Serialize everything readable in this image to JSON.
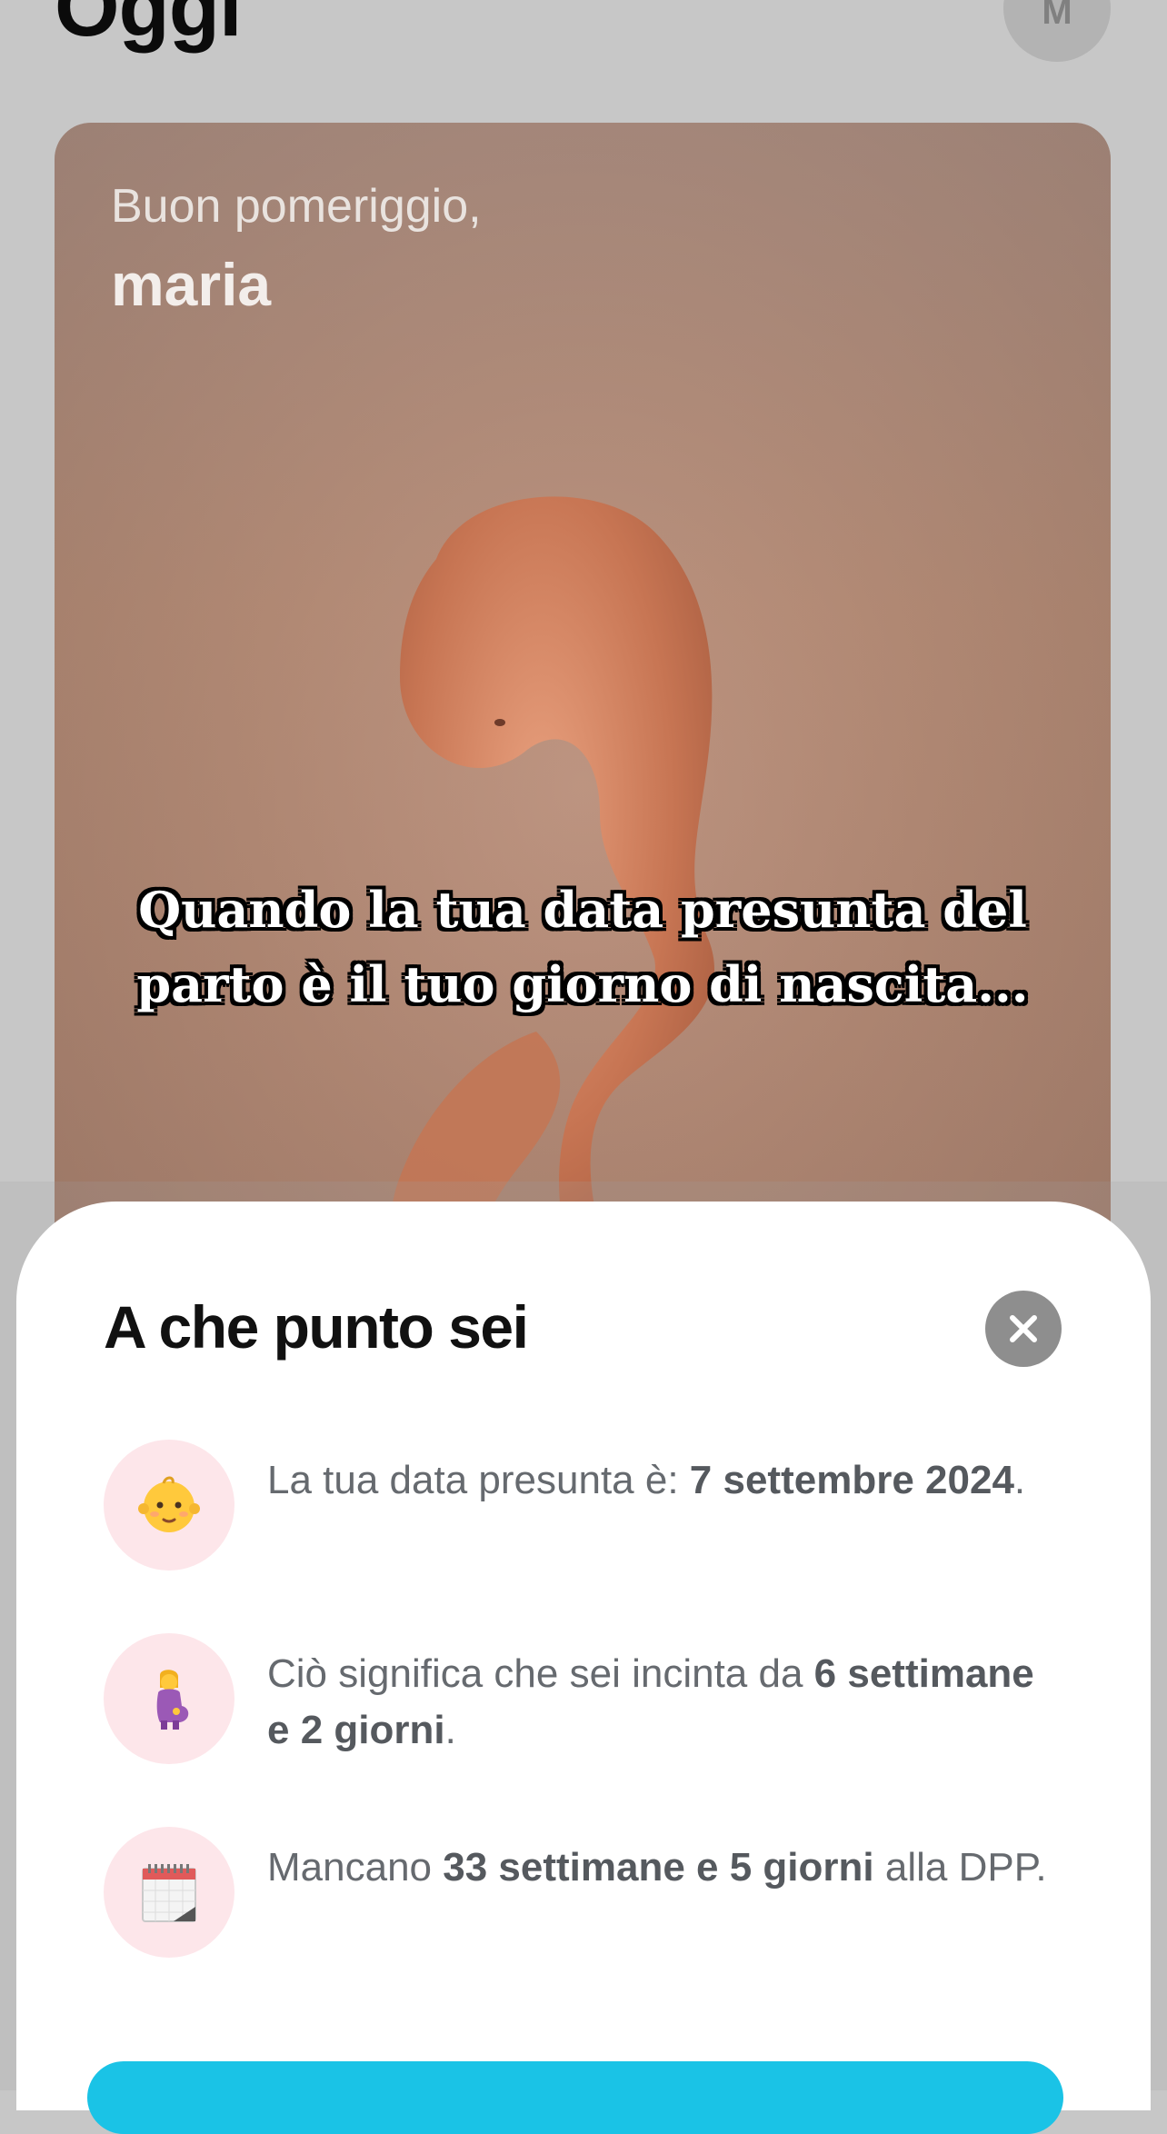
{
  "header": {
    "title": "Oggi",
    "avatar_initial": "M"
  },
  "hero": {
    "greeting": "Buon pomeriggio,",
    "name": "maria",
    "caption_line1": "Quando la tua data presunta del",
    "caption_line2": "parto è il tuo giorno di nascita..."
  },
  "sheet": {
    "title": "A che punto sei",
    "rows": [
      {
        "icon": "baby-face-icon",
        "prefix": "La tua data presunta è: ",
        "bold": "7 settembre 2024",
        "suffix": "."
      },
      {
        "icon": "pregnant-woman-icon",
        "prefix": "Ciò significa che sei incinta da ",
        "bold": "6 settimane e 2 giorni",
        "suffix": "."
      },
      {
        "icon": "calendar-icon",
        "prefix": "Mancano ",
        "bold": "33 settimane e 5 giorni",
        "suffix": " alla DPP."
      }
    ]
  },
  "colors": {
    "background": "#c7c7c7",
    "icon_bubble": "#fde6ea",
    "cta": "#1ac3e6",
    "close_button": "#8e8e8e"
  }
}
